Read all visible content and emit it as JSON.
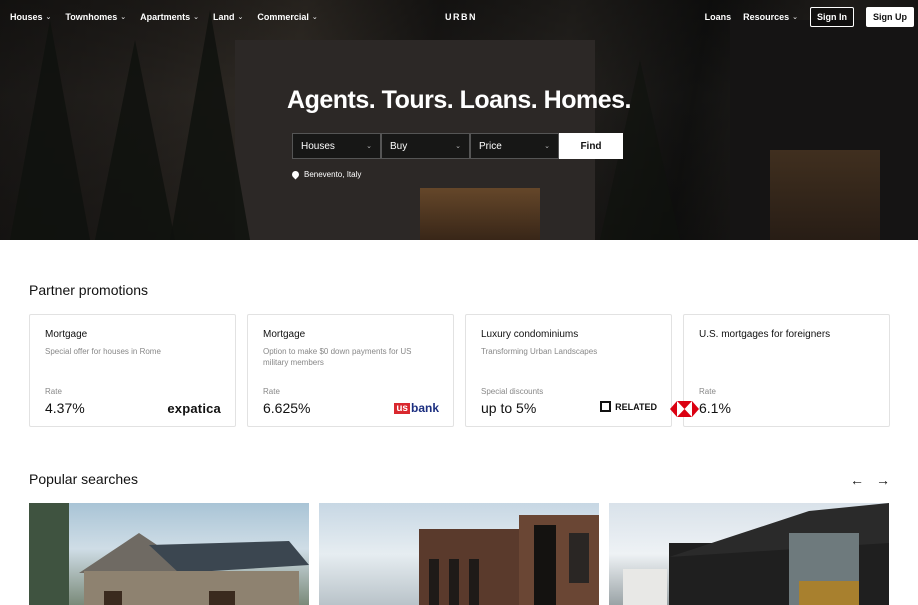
{
  "nav": {
    "left_items": [
      {
        "label": "Houses"
      },
      {
        "label": "Townhomes"
      },
      {
        "label": "Apartments"
      },
      {
        "label": "Land"
      },
      {
        "label": "Commercial"
      }
    ],
    "logo": "URBN",
    "loans": "Loans",
    "resources": "Resources",
    "sign_in": "Sign In",
    "sign_up": "Sign Up"
  },
  "hero": {
    "headline": "Agents. Tours. Loans. Homes.",
    "search": {
      "type": "Houses",
      "mode": "Buy",
      "price": "Price",
      "find_label": "Find"
    },
    "location": "Benevento, Italy"
  },
  "promotions": {
    "title": "Partner promotions",
    "cards": [
      {
        "title": "Mortgage",
        "desc": "Special offer for houses in Rome",
        "label": "Rate",
        "value": "4.37%",
        "brand": "expatica"
      },
      {
        "title": "Mortgage",
        "desc": "Option to make $0 down payments for US military members",
        "label": "Rate",
        "value": "6.625%",
        "brand_prefix": "us",
        "brand": "bank"
      },
      {
        "title": "Luxury condominiums",
        "desc": "Transforming Urban Landscapes",
        "label": "Special discounts",
        "value": "up to 5%",
        "brand": "RELATED"
      },
      {
        "title": "U.S. mortgages for foreigners",
        "desc": "",
        "label": "Rate",
        "value": "6.1%",
        "brand": "hsbc-logo"
      }
    ]
  },
  "popular": {
    "title": "Popular searches",
    "prev_icon": "arrow-left-icon",
    "next_icon": "arrow-right-icon"
  }
}
